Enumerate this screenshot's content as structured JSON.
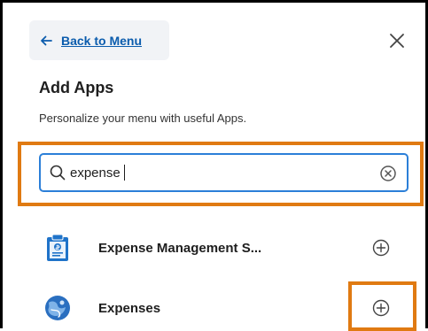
{
  "panel": {
    "back_label": "Back to Menu",
    "title": "Add Apps",
    "subtitle": "Personalize your menu with useful Apps."
  },
  "search": {
    "value": "expense",
    "placeholder": "",
    "icon": "search-icon",
    "clear_icon": "clear-icon"
  },
  "results": [
    {
      "label": "Expense Management S...",
      "icon": "expense-management-icon",
      "action_icon": "add-icon"
    },
    {
      "label": "Expenses",
      "icon": "expenses-icon",
      "action_icon": "add-icon"
    }
  ],
  "colors": {
    "link": "#0b5cad",
    "search_border": "#2b7fd8",
    "highlight": "#e07a12",
    "back_bg": "#f1f3f6"
  }
}
